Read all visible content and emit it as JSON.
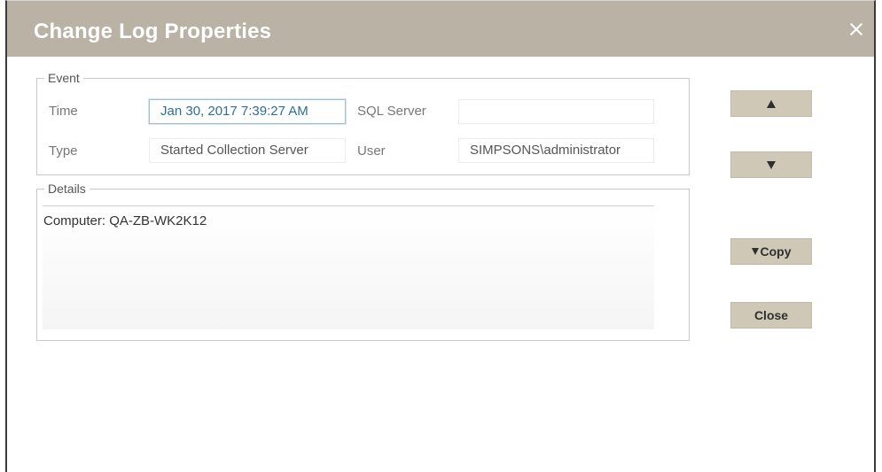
{
  "dialog": {
    "title": "Change Log Properties",
    "close_icon": "close-icon"
  },
  "event": {
    "legend": "Event",
    "time_label": "Time",
    "time_value": "Jan 30, 2017 7:39:27 AM",
    "sql_server_label": "SQL Server",
    "sql_server_value": "",
    "type_label": "Type",
    "type_value": "Started Collection Server",
    "user_label": "User",
    "user_value": "SIMPSONS\\administrator"
  },
  "details": {
    "legend": "Details",
    "text": "Computer: QA-ZB-WK2K12"
  },
  "buttons": {
    "up_icon": "up-arrow-icon",
    "down_icon": "down-arrow-icon",
    "copy_label": "Copy",
    "close_label": "Close"
  },
  "colors": {
    "titlebar": "#b9b2a5",
    "button": "#cfc8b6",
    "focus_text": "#2e6e96"
  }
}
